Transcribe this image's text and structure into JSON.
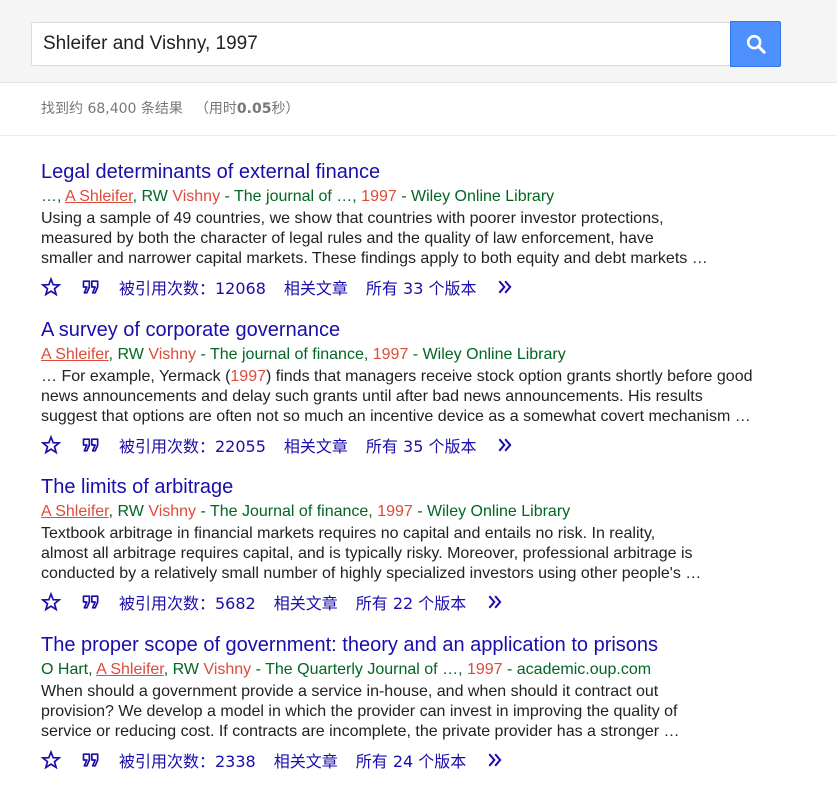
{
  "search": {
    "query": "Shleifer and Vishny, 1997"
  },
  "stats": {
    "prefix": "找到约 68,400 条结果",
    "time_prefix": "（用时",
    "time_value": "0.05",
    "time_suffix": "秒）"
  },
  "results": [
    {
      "title": "Legal determinants of external finance",
      "meta_lead": "…, ",
      "authors": [
        {
          "text": "A Shleifer",
          "linked": true
        },
        {
          "text": ", RW ",
          "linked": false
        }
      ],
      "meta_vishny": "Vishny",
      "meta_source": " - The journal of …, ",
      "meta_year": "1997",
      "meta_host": " - Wiley Online Library",
      "snippet": [
        "Using a sample of 49 countries, we show that countries with poorer investor protections,",
        "measured by both the character of legal rules and the quality of law enforcement, have",
        "smaller and narrower capital markets. These findings apply to both equity and debt markets …"
      ],
      "cited": "被引用次数：12068",
      "related": "相关文章",
      "versions": "所有 33 个版本"
    },
    {
      "title": "A survey of corporate governance",
      "meta_lead": "",
      "authors": [
        {
          "text": "A Shleifer",
          "linked": true
        },
        {
          "text": ", RW ",
          "linked": false
        }
      ],
      "meta_vishny": "Vishny",
      "meta_source": " - The journal of finance, ",
      "meta_year": "1997",
      "meta_host": " - Wiley Online Library",
      "snippet_parts": {
        "line1_before": "… For example, Yermack (",
        "line1_year": "1997",
        "line1_after": ") finds that managers receive stock option grants shortly before good",
        "line2": "news announcements and delay such grants until after bad news announcements. His results",
        "line3": "suggest that options are often not so much an incentive device as a somewhat covert mechanism …"
      },
      "cited": "被引用次数：22055",
      "related": "相关文章",
      "versions": "所有 35 个版本"
    },
    {
      "title": "The limits of arbitrage",
      "meta_lead": "",
      "authors": [
        {
          "text": "A Shleifer",
          "linked": true
        },
        {
          "text": ", RW ",
          "linked": false
        }
      ],
      "meta_vishny": "Vishny",
      "meta_source": " - The Journal of finance, ",
      "meta_year": "1997",
      "meta_host": " - Wiley Online Library",
      "snippet": [
        "Textbook arbitrage in financial markets requires no capital and entails no risk. In reality,",
        "almost all arbitrage requires capital, and is typically risky. Moreover, professional arbitrage is",
        "conducted by a relatively small number of highly specialized investors using other people's …"
      ],
      "cited": "被引用次数：5682",
      "related": "相关文章",
      "versions": "所有 22 个版本"
    },
    {
      "title": "The proper scope of government: theory and an application to prisons",
      "meta_lead": "O Hart, ",
      "authors": [
        {
          "text": "A Shleifer",
          "linked": true
        },
        {
          "text": ", RW ",
          "linked": false
        }
      ],
      "meta_vishny": "Vishny",
      "meta_source": " - The Quarterly Journal of …, ",
      "meta_year": "1997",
      "meta_host": " - academic.oup.com",
      "snippet": [
        "When should a government provide a service in-house, and when should it contract out",
        "provision? We develop a model in which the provider can invest in improving the quality of",
        "service or reducing cost. If contracts are incomplete, the private provider has a stronger …"
      ],
      "cited": "被引用次数：2338",
      "related": "相关文章",
      "versions": "所有 24 个版本"
    }
  ],
  "colors": {
    "title": "#1a0dab",
    "meta": "#006621",
    "highlight": "#dd4b39",
    "search_button": "#4d90fe"
  }
}
